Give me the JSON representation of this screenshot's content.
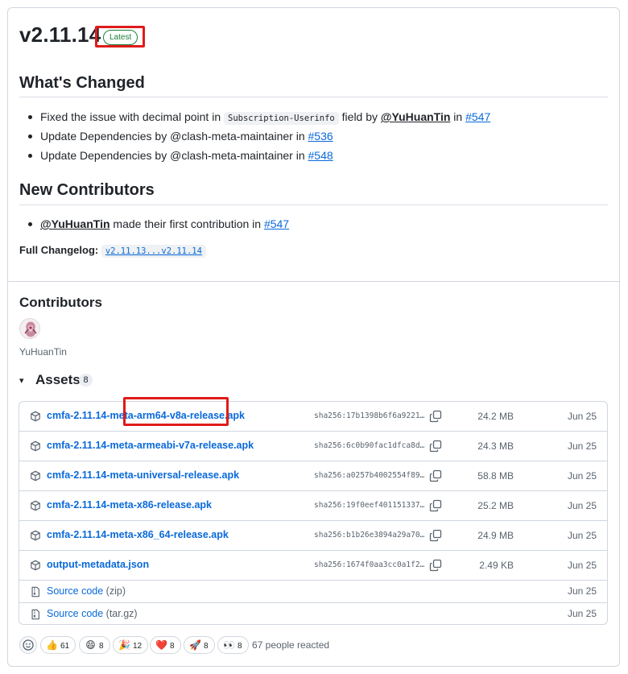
{
  "release": {
    "title": "v2.11.14",
    "badge": "Latest"
  },
  "whats_changed": {
    "heading": "What's Changed",
    "items": [
      {
        "pre": "Fixed the issue with decimal point in ",
        "code": "Subscription-Userinfo",
        "mid": " field by ",
        "user": "@YuHuanTin",
        "in": " in ",
        "ref": "#547"
      },
      {
        "pre": "Update Dependencies by @clash-meta-maintainer in ",
        "ref": "#536"
      },
      {
        "pre": "Update Dependencies by @clash-meta-maintainer in ",
        "ref": "#548"
      }
    ]
  },
  "new_contributors": {
    "heading": "New Contributors",
    "items": [
      {
        "user": "@YuHuanTin",
        "text": " made their first contribution in ",
        "ref": "#547"
      }
    ]
  },
  "changelog": {
    "label": "Full Changelog",
    "sep": ": ",
    "link": "v2.11.13...v2.11.14"
  },
  "contributors": {
    "heading": "Contributors",
    "names": [
      "YuHuanTin"
    ]
  },
  "assets": {
    "toggle": "▾",
    "heading": "Assets",
    "count": "8",
    "rows": [
      {
        "name": "cmfa-2.11.14-meta-arm64-v8a-release.apk",
        "sha": "sha256:17b1398b6f6a9221…",
        "size": "24.2 MB",
        "date": "Jun 25",
        "icon": "package-icon"
      },
      {
        "name": "cmfa-2.11.14-meta-armeabi-v7a-release.apk",
        "sha": "sha256:6c0b90fac1dfca8d…",
        "size": "24.3 MB",
        "date": "Jun 25",
        "icon": "package-icon"
      },
      {
        "name": "cmfa-2.11.14-meta-universal-release.apk",
        "sha": "sha256:a0257b4002554f89…",
        "size": "58.8 MB",
        "date": "Jun 25",
        "icon": "package-icon"
      },
      {
        "name": "cmfa-2.11.14-meta-x86-release.apk",
        "sha": "sha256:19f0eef401151337…",
        "size": "25.2 MB",
        "date": "Jun 25",
        "icon": "package-icon"
      },
      {
        "name": "cmfa-2.11.14-meta-x86_64-release.apk",
        "sha": "sha256:b1b26e3894a29a70…",
        "size": "24.9 MB",
        "date": "Jun 25",
        "icon": "package-icon"
      },
      {
        "name": "output-metadata.json",
        "sha": "sha256:1674f0aa3cc0a1f2…",
        "size": "2.49 KB",
        "date": "Jun 25",
        "icon": "package-icon"
      }
    ],
    "source": [
      {
        "name": "Source code",
        "ext": "(zip)",
        "date": "Jun 25",
        "icon": "file-zip-icon"
      },
      {
        "name": "Source code",
        "ext": "(tar.gz)",
        "date": "Jun 25",
        "icon": "file-zip-icon"
      }
    ]
  },
  "reactions": {
    "items": [
      {
        "emoji": "👍",
        "count": "61",
        "icon": "thumbs-up-icon"
      },
      {
        "emoji": "😄",
        "count": "8",
        "icon": "laugh-icon"
      },
      {
        "emoji": "🎉",
        "count": "12",
        "icon": "hooray-icon"
      },
      {
        "emoji": "❤️",
        "count": "8",
        "icon": "heart-icon"
      },
      {
        "emoji": "🚀",
        "count": "8",
        "icon": "rocket-icon"
      },
      {
        "emoji": "👀",
        "count": "8",
        "icon": "eyes-icon"
      }
    ],
    "summary": "67 people reacted"
  },
  "colors": {
    "link": "#0969da",
    "latest_green": "#1a7f37",
    "highlight": "#e01b1b",
    "muted": "#59636e"
  }
}
